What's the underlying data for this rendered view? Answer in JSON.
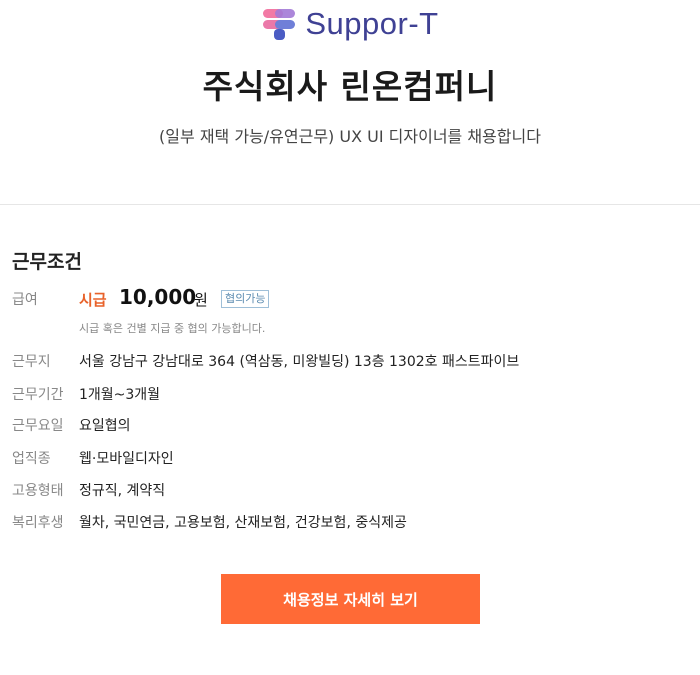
{
  "brand": {
    "name": "Suppor-T",
    "logo_icon": "suppor-t-logo-icon"
  },
  "job": {
    "company": "주식회사 린온컴퍼니",
    "title": "(일부 재택 가능/유연근무) UX UI 디자이너를 채용합니다"
  },
  "conditions": {
    "heading": "근무조건",
    "salary": {
      "label": "급여",
      "type": "시급",
      "amount": "10,000",
      "unit": "원",
      "badge": "협의가능",
      "note": "시급 혹은 건별 지급 중 협의 가능합니다."
    },
    "rows": [
      {
        "label": "근무지",
        "value": "서울 강남구 강남대로 364 (역삼동, 미왕빌딩) 13층 1302호 패스트파이브"
      },
      {
        "label": "근무기간",
        "value": "1개월~3개월"
      },
      {
        "label": "근무요일",
        "value": "요일협의"
      },
      {
        "label": "업직종",
        "value": "웹·모바일디자인"
      },
      {
        "label": "고용형태",
        "value": "정규직, 계약직"
      },
      {
        "label": "복리후생",
        "value": "월차, 국민연금, 고용보험, 산재보험, 건강보험, 중식제공"
      }
    ]
  },
  "cta": {
    "label": "채용정보 자세히 보기"
  },
  "colors": {
    "accent": "#ff6a36",
    "brand": "#3f4194",
    "pay_type": "#e8622a"
  }
}
